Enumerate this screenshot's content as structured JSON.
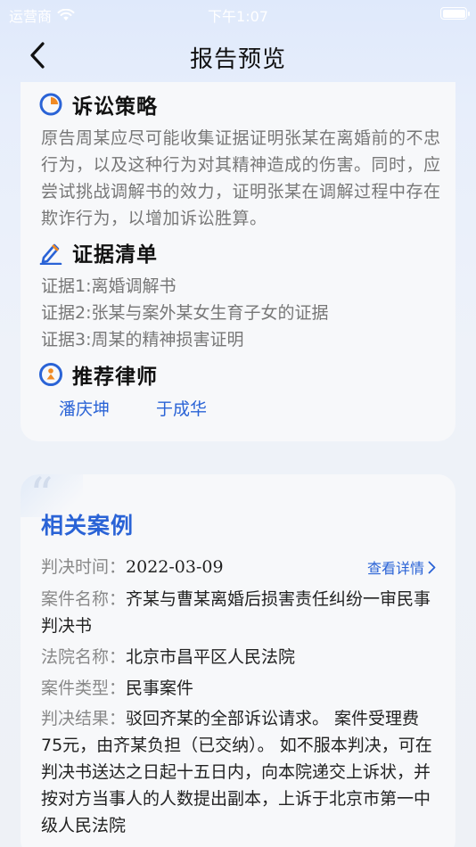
{
  "status_bar": {
    "carrier": "运营商",
    "time": "下午1:07"
  },
  "nav": {
    "title": "报告预览"
  },
  "strategy": {
    "title": "诉讼策略",
    "text": "原告周某应尽可能收集证据证明张某在离婚前的不忠行为，以及这种行为对其精神造成的伤害。同时，应尝试挑战调解书的效力，证明张某在调解过程中存在欺诈行为，以增加诉讼胜算。"
  },
  "evidence": {
    "title": "证据清单",
    "items": [
      "证据1:离婚调解书",
      "证据2:张某与案外某女生育子女的证据",
      "证据3:周某的精神损害证明"
    ]
  },
  "lawyers": {
    "title": "推荐律师",
    "names": [
      "潘庆坤",
      "于成华"
    ]
  },
  "cases": {
    "title": "相关案例",
    "quote_mark": "“",
    "detail_link": "查看详情",
    "date_label": "判决时间：",
    "date_value": "2022-03-09",
    "name_label": "案件名称：",
    "name_value": "齐某与曹某离婚后损害责任纠纷一审民事判决书",
    "court_label": "法院名称：",
    "court_value": "北京市昌平区人民法院",
    "type_label": "案件类型：",
    "type_value": "民事案件",
    "result_label": "判决结果：",
    "result_value": "驳回齐某的全部诉讼请求。 案件受理费75元，由齐某负担（已交纳）。 如不服本判决，可在判决书送达之日起十五日内，向本院递交上诉状，并按对方当事人的人数提出副本，上诉于北京市第一中级人民法院"
  },
  "colors": {
    "accent": "#2a63d6",
    "icon_orange": "#f08a24",
    "muted_text": "#777777"
  }
}
